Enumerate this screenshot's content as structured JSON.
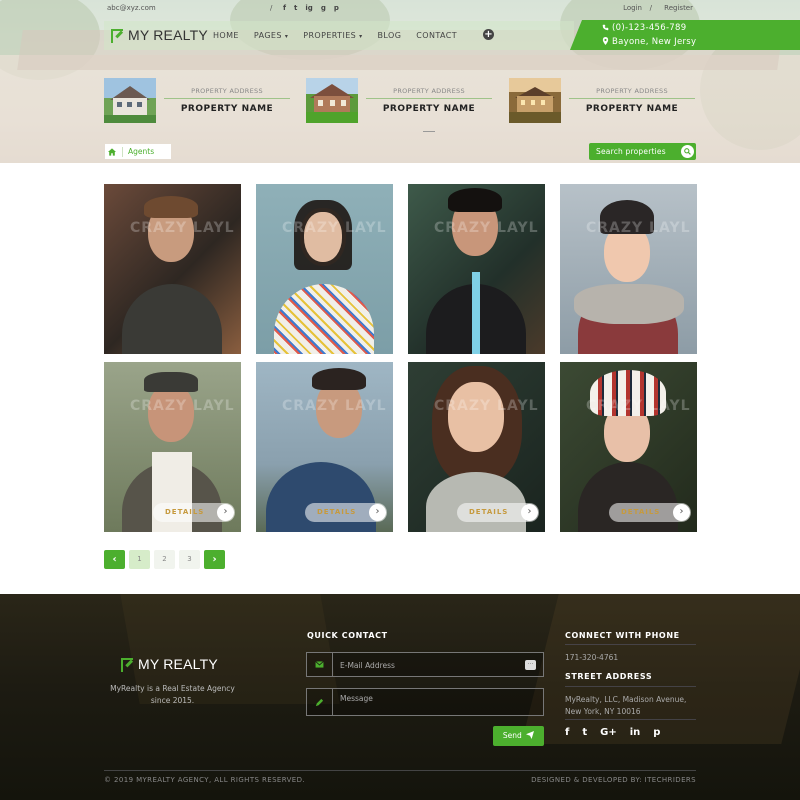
{
  "topbar": {
    "email": "abc@xyz.com",
    "separator": "/",
    "socials": [
      "f",
      "t",
      "ig",
      "g",
      "p"
    ],
    "login": "Login",
    "register_sep": "/",
    "register": "Register"
  },
  "brand": {
    "name": "MY REALTY",
    "accent": "#4caf2e"
  },
  "nav": {
    "items": [
      "HOME",
      "PAGES",
      "PROPERTIES",
      "BLOG",
      "CONTACT"
    ],
    "dropdown_marker": "▾"
  },
  "contact": {
    "phone": "(0)-123-456-789",
    "location": "Bayone, New Jersy"
  },
  "properties": [
    {
      "label": "PROPERTY ADDRESS",
      "name": "PROPERTY NAME"
    },
    {
      "label": "PROPERTY ADDRESS",
      "name": "PROPERTY NAME"
    },
    {
      "label": "PROPERTY ADDRESS",
      "name": "PROPERTY NAME"
    }
  ],
  "breadcrumb": {
    "current": "Agents"
  },
  "search": {
    "label": "Search properties"
  },
  "agents": {
    "details_label": "DETAILS",
    "watermark": "CRAZY LAYL",
    "count": 8
  },
  "pagination": {
    "pages": [
      "1",
      "2",
      "3"
    ],
    "prev": "‹",
    "next": "›",
    "current": 1
  },
  "footer": {
    "brand": "MY REALTY",
    "tagline": "MyRealty is a Real Estate Agency since 2015.",
    "quick_contact": {
      "heading": "QUICK CONTACT",
      "email_placeholder": "E-Mail Address",
      "message_placeholder": "Message",
      "send": "Send"
    },
    "connect_heading": "CONNECT WITH PHONE",
    "phone": "171-320-4761",
    "street_heading": "STREET ADDRESS",
    "address_line1": "MyRealty, LLC, Madison Avenue,",
    "address_line2": "New York, NY 10016",
    "socials": [
      "f",
      "t",
      "G+",
      "in",
      "p"
    ],
    "copyright": "© 2019 MYREALTY AGENCY, ALL RIGHTS RESERVED.",
    "designed_by": "DESIGNED & DEVELOPED BY: ITECHRIDERS"
  }
}
